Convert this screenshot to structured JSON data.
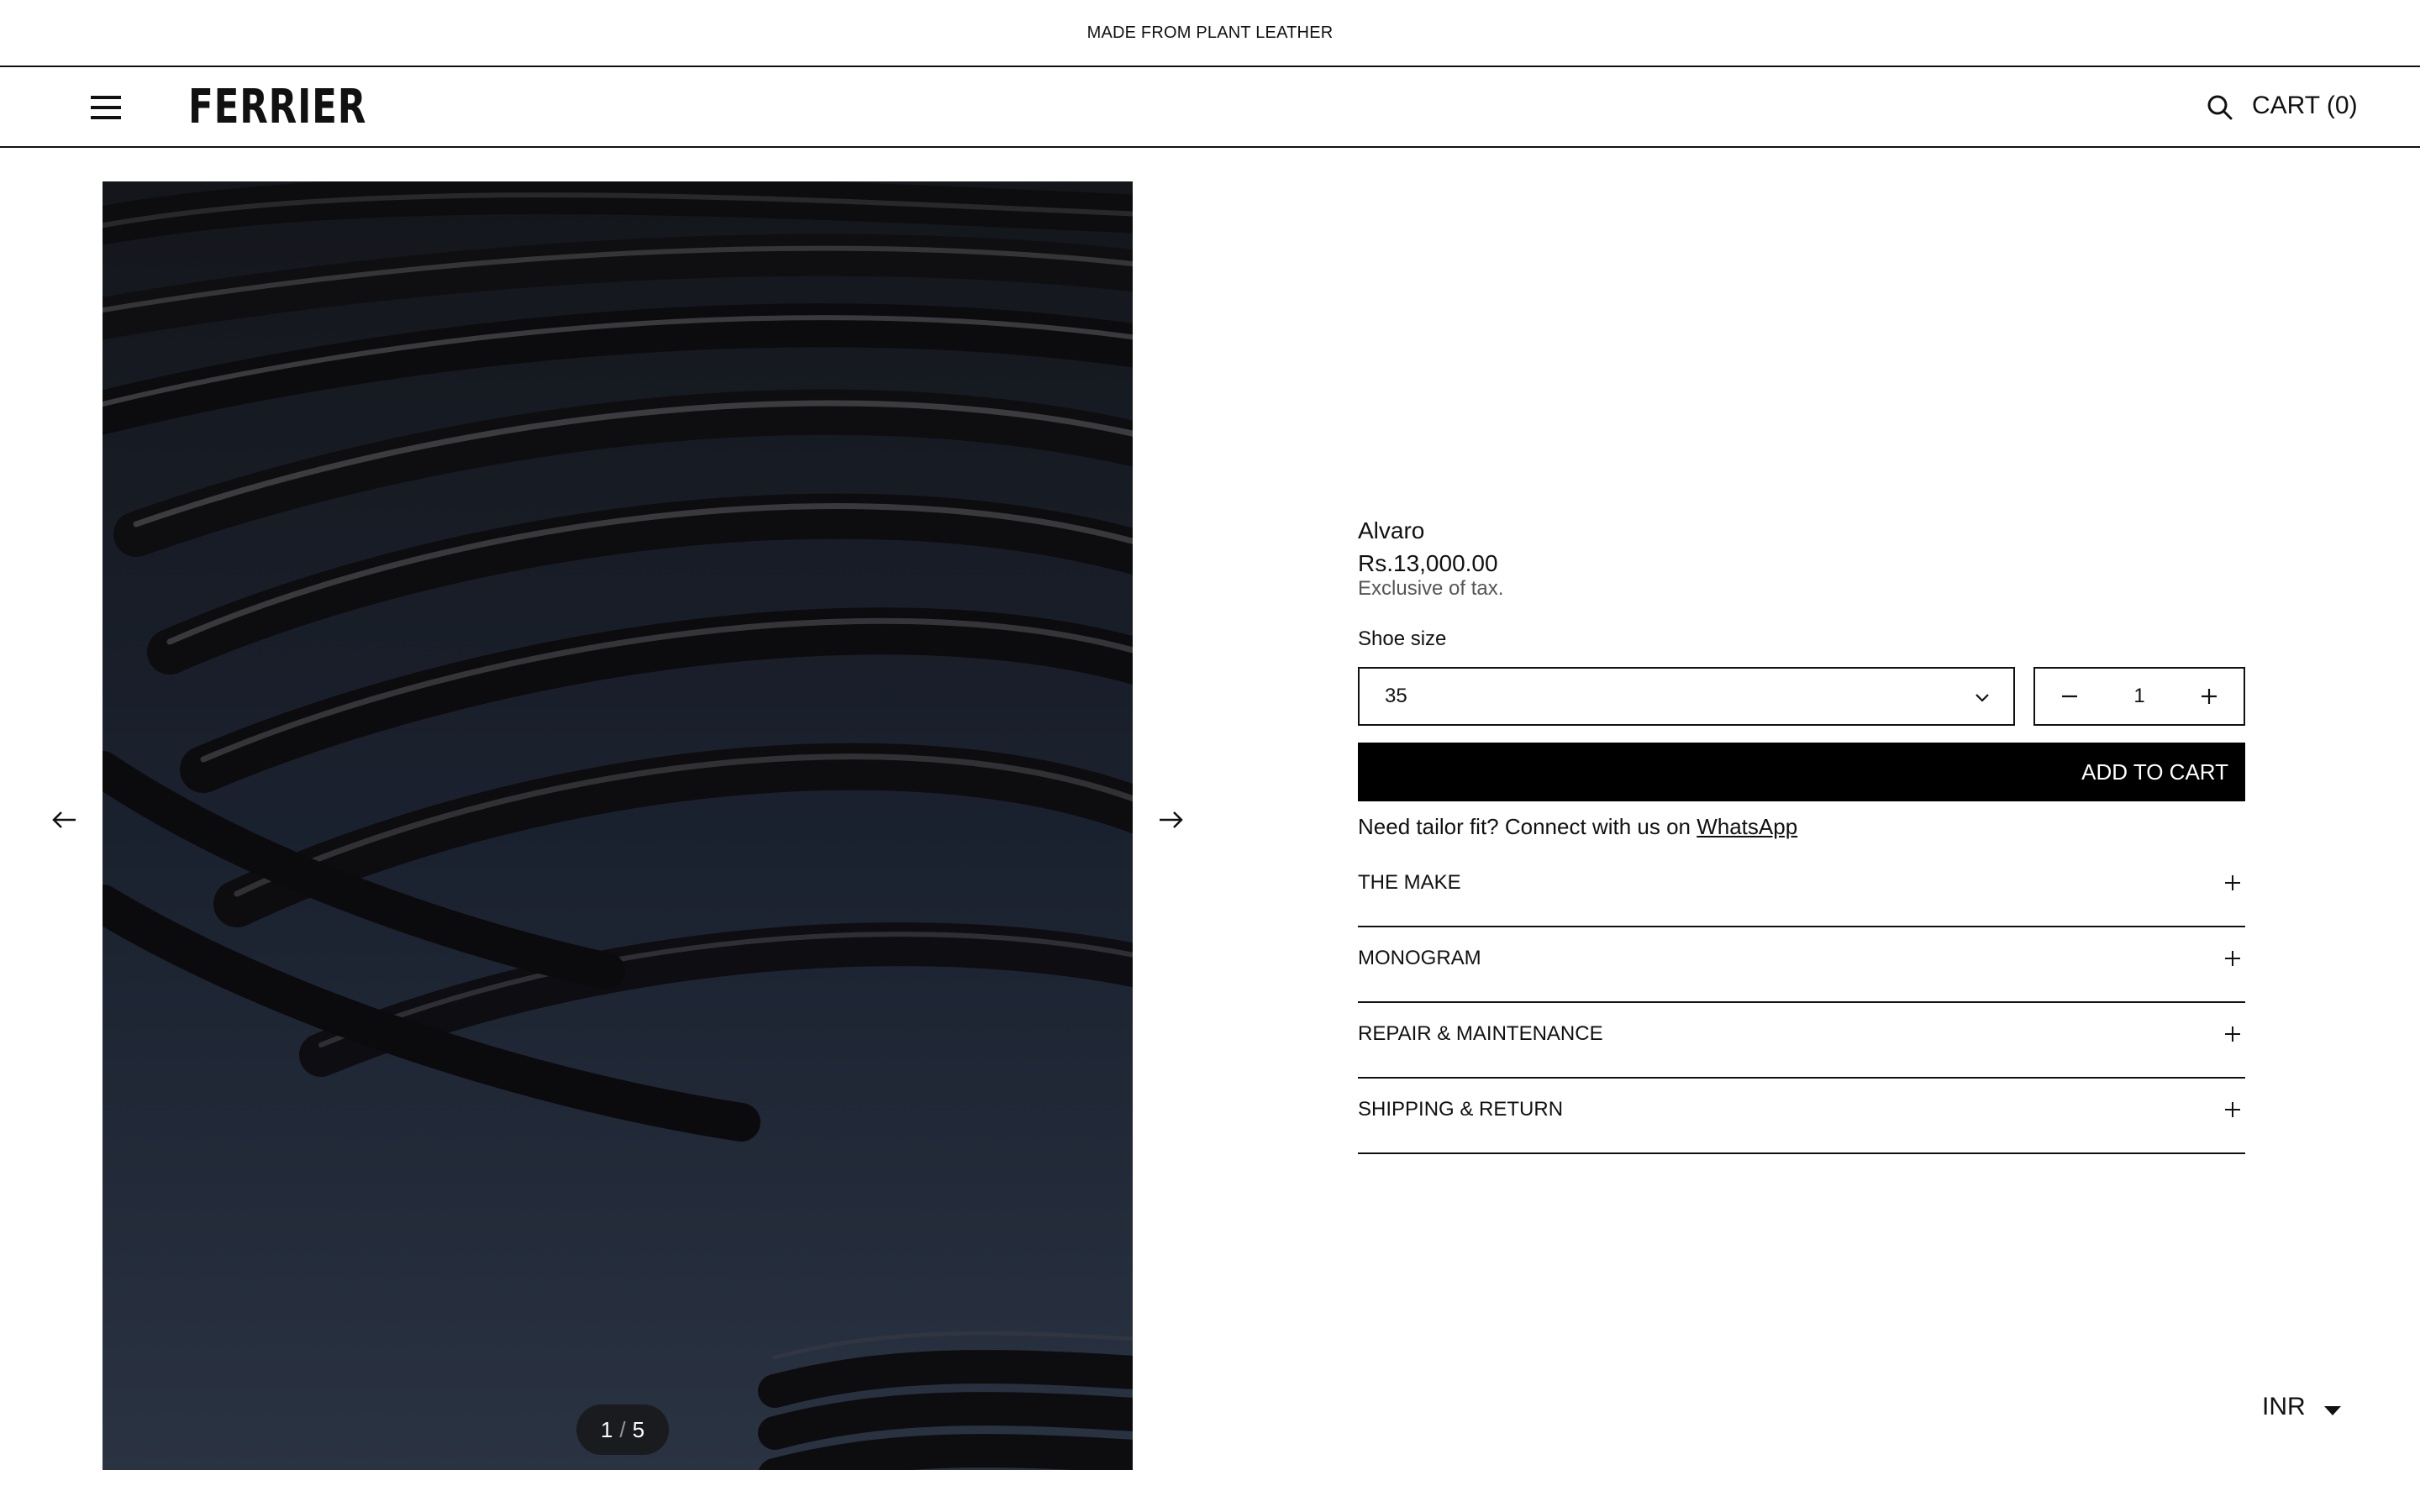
{
  "announcement": "MADE FROM PLANT LEATHER",
  "header": {
    "logo": "FERRIER",
    "cart_label": "CART (0)",
    "icons": [
      "menu-icon",
      "search-icon"
    ]
  },
  "gallery": {
    "counter_current": "1",
    "counter_sep": "/",
    "counter_total": "5",
    "image_subject": "black leather cords close-up"
  },
  "product": {
    "title": "Alvaro",
    "price": "Rs.13,000.00",
    "tax_note": "Exclusive of tax.",
    "size_label": "Shoe size",
    "size_selected": "35",
    "quantity": "1",
    "add_to_cart": "ADD TO CART",
    "tailor_text": "Need tailor fit? Connect with us on ",
    "tailor_link": "WhatsApp",
    "accordion": [
      {
        "label": "THE MAKE"
      },
      {
        "label": "MONOGRAM"
      },
      {
        "label": "REPAIR & MAINTENANCE"
      },
      {
        "label": "SHIPPING & RETURN"
      }
    ]
  },
  "currency": "INR",
  "colors": {
    "text": "#111111",
    "button_bg": "#000000",
    "button_text": "#ffffff",
    "tax_text": "#555555"
  }
}
